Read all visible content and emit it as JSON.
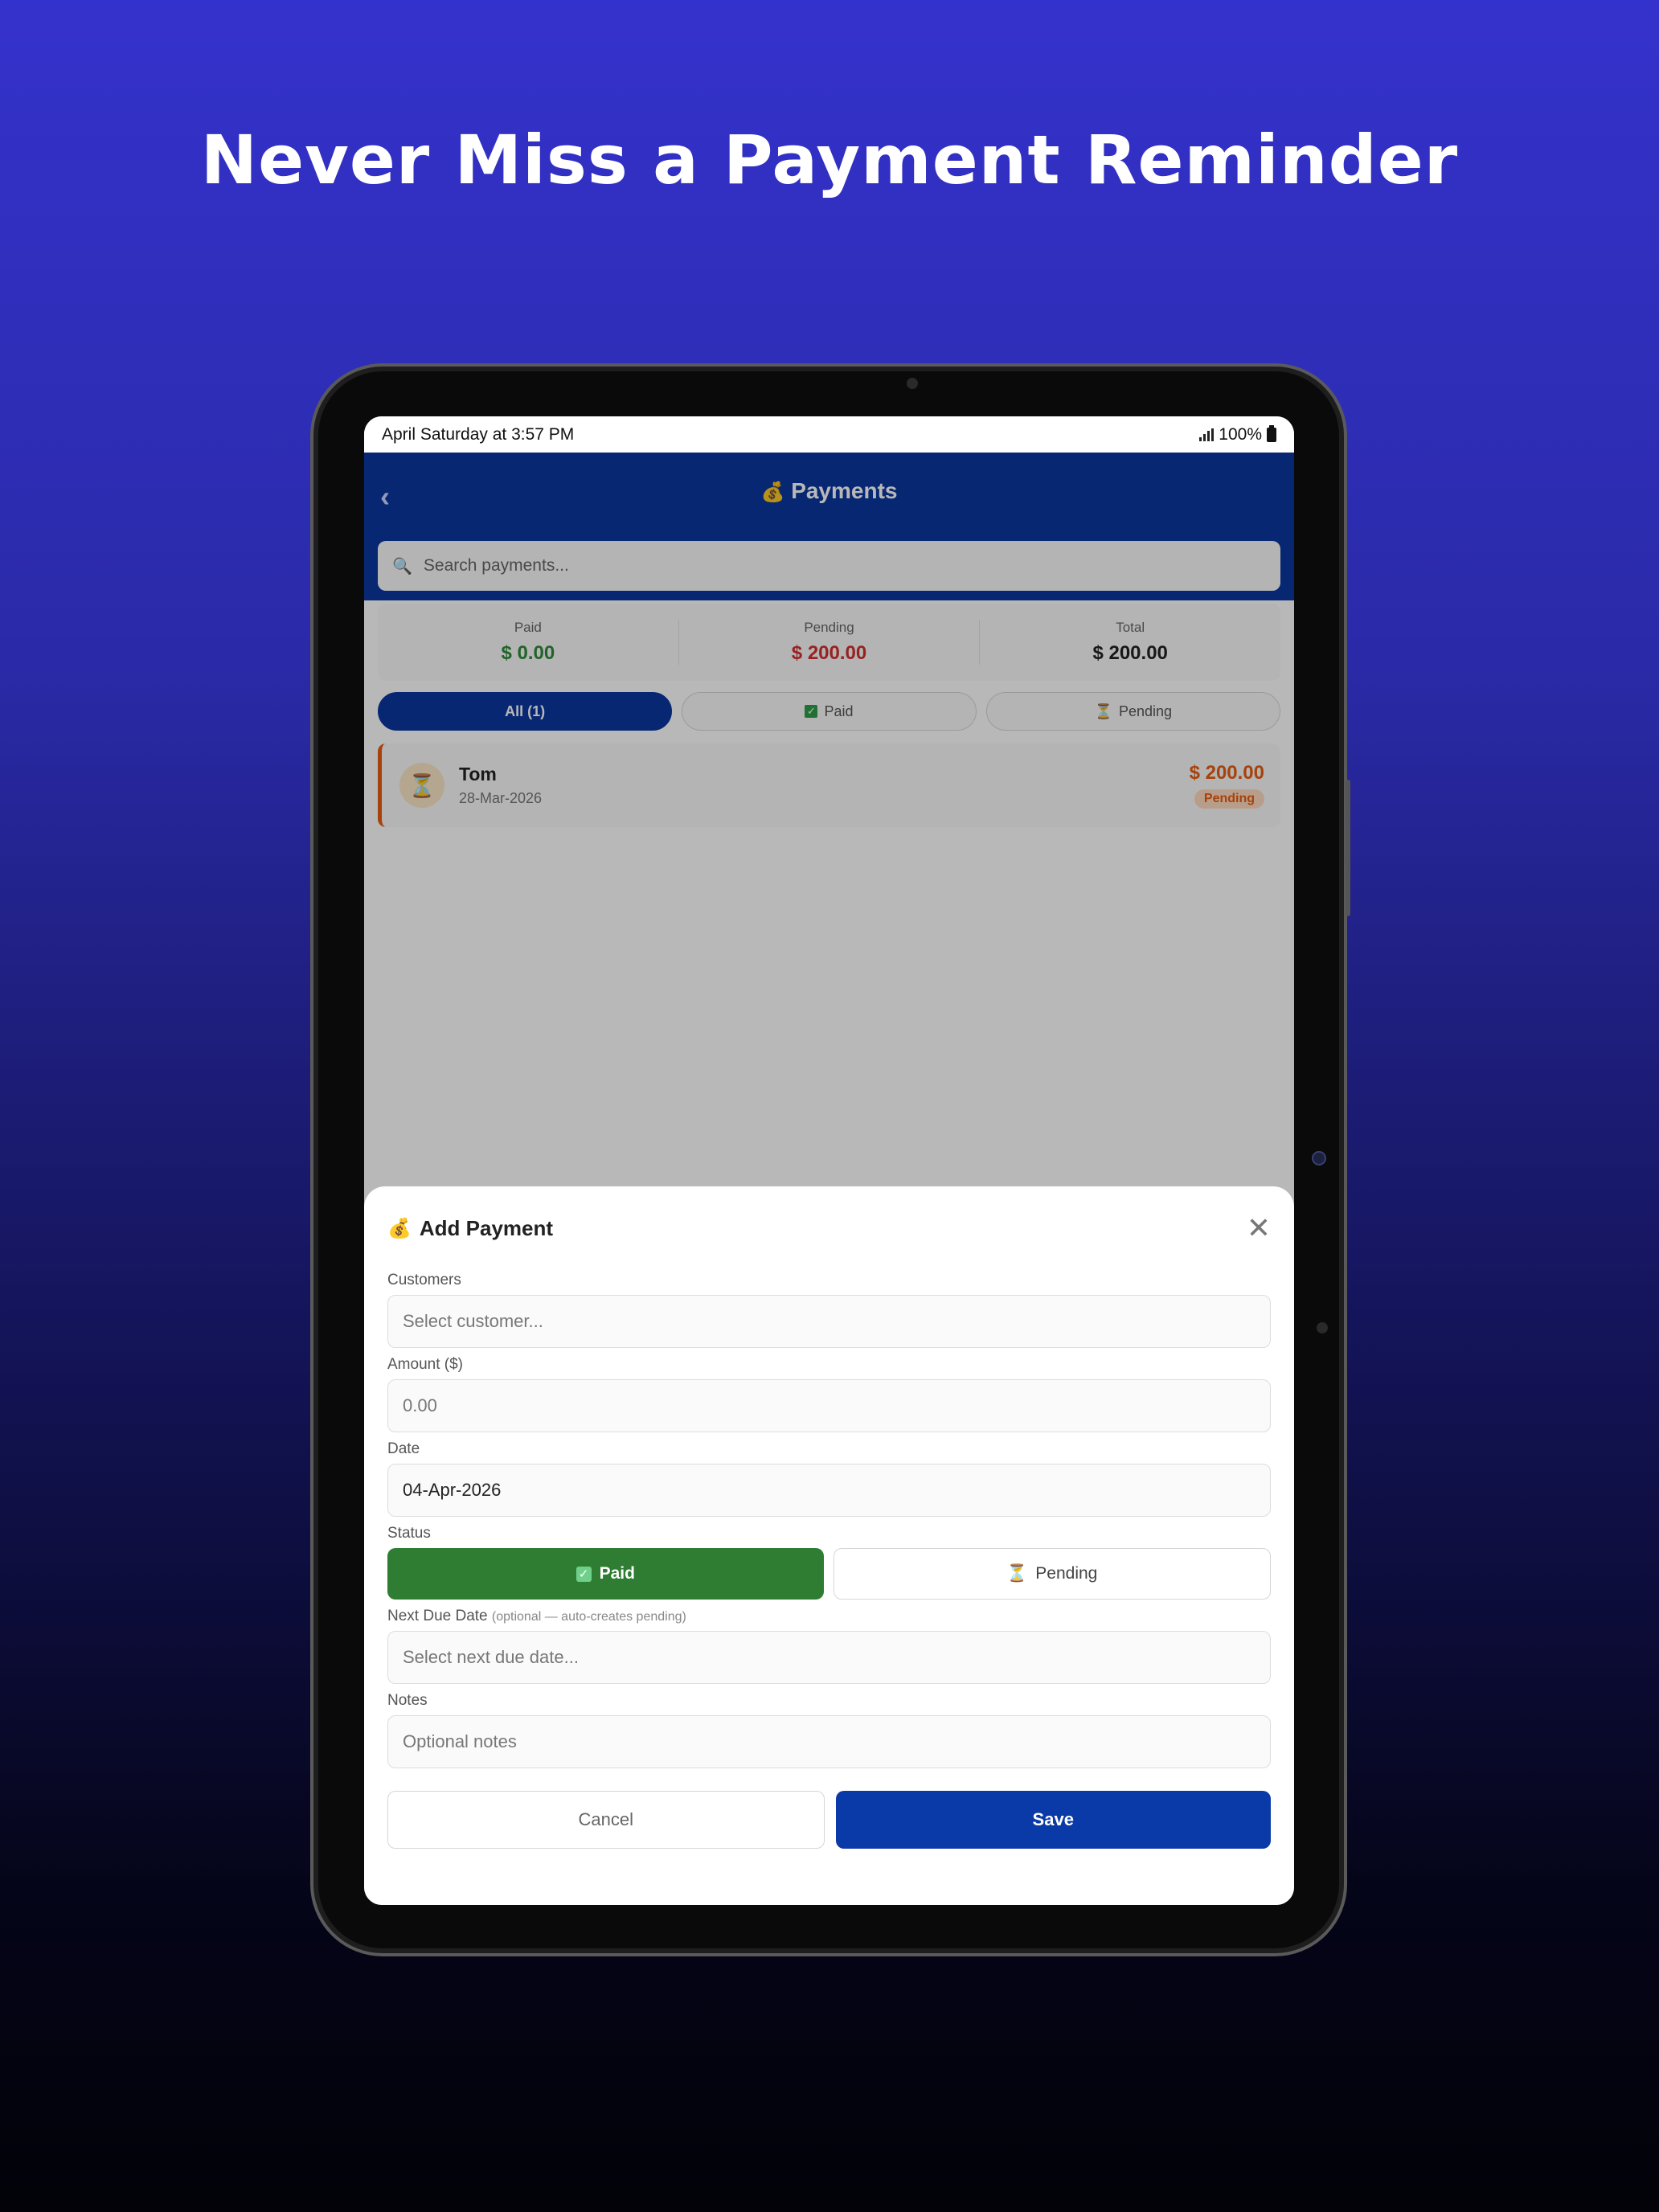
{
  "headline": "Never Miss a Payment Reminder",
  "status_bar": {
    "time": "April Saturday at 3:57 PM",
    "battery": "100%"
  },
  "appbar": {
    "title": "Payments",
    "back_icon": "chevron-left-icon",
    "title_icon": "money-bag-icon"
  },
  "search": {
    "placeholder": "Search payments..."
  },
  "summary": [
    {
      "label": "Paid",
      "value": "$ 0.00",
      "color": "#2e8b3a"
    },
    {
      "label": "Pending",
      "value": "$ 200.00",
      "color": "#d32f2f"
    },
    {
      "label": "Total",
      "value": "$ 200.00",
      "color": "#222222"
    }
  ],
  "filters": [
    {
      "label": "All (1)",
      "active": true
    },
    {
      "label": "Paid",
      "icon": "check-box-icon"
    },
    {
      "label": "Pending",
      "icon": "hourglass-icon"
    }
  ],
  "payments": [
    {
      "name": "Tom",
      "date": "28-Mar-2026",
      "amount": "$ 200.00",
      "status": "Pending"
    }
  ],
  "sheet": {
    "title": "Add Payment",
    "customers_label": "Customers",
    "customers_placeholder": "Select customer...",
    "amount_label": "Amount ($)",
    "amount_placeholder": "0.00",
    "date_label": "Date",
    "date_value": "04-Apr-2026",
    "status_label": "Status",
    "status_paid": "Paid",
    "status_pending": "Pending",
    "next_due_label": "Next Due Date",
    "next_due_hint": "(optional — auto-creates pending)",
    "next_due_placeholder": "Select next due date...",
    "notes_label": "Notes",
    "notes_placeholder": "Optional notes",
    "cancel": "Cancel",
    "save": "Save"
  },
  "colors": {
    "primary": "#0a36a0",
    "paid_green": "#2e7d32",
    "pending_orange": "#e65c10"
  }
}
